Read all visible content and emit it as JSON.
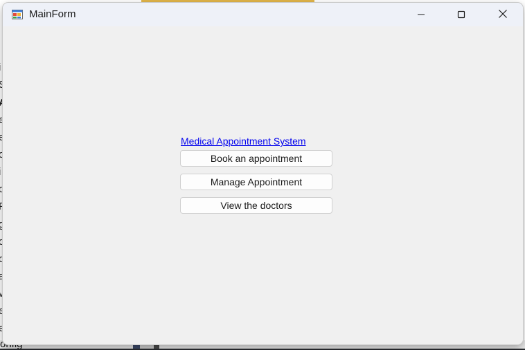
{
  "window": {
    "title": "MainForm"
  },
  "main": {
    "link_label": "Medical Appointment System",
    "buttons": [
      {
        "label": "Book an appointment"
      },
      {
        "label": "Manage Appointment"
      },
      {
        "label": "View the doctors"
      }
    ]
  },
  "background_app": {
    "visible_edge_text": [
      "i",
      "S",
      "A",
      "e",
      "e",
      "o",
      "i",
      "o",
      "F",
      "g",
      "o",
      "o",
      "a",
      "v",
      "e",
      "e"
    ],
    "bottom_text": "onfig"
  },
  "icons": {
    "app": "winforms-app-icon",
    "minimize": "minimize-icon",
    "maximize": "maximize-icon",
    "close": "close-icon"
  },
  "colors": {
    "link": "#0000ee",
    "titlebar": "#eef1f8",
    "client": "#f0f0f0"
  }
}
